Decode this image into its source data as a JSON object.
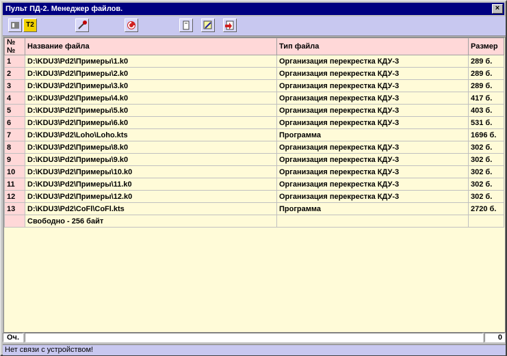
{
  "window": {
    "title": "Пульт ПД-2. Менеджер файлов.",
    "close_label": "×"
  },
  "toolbar": {
    "t2_label": "T2"
  },
  "table": {
    "headers": [
      "№№",
      "Название файла",
      "Тип файла",
      "Размер"
    ],
    "rows": [
      [
        "1",
        "D:\\KDU3\\Pd2\\Примеры\\1.k0",
        "Организация перекрестка КДУ-3",
        "289 б."
      ],
      [
        "2",
        "D:\\KDU3\\Pd2\\Примеры\\2.k0",
        "Организация перекрестка КДУ-3",
        "289 б."
      ],
      [
        "3",
        "D:\\KDU3\\Pd2\\Примеры\\3.k0",
        "Организация перекрестка КДУ-3",
        "289 б."
      ],
      [
        "4",
        "D:\\KDU3\\Pd2\\Примеры\\4.k0",
        "Организация перекрестка КДУ-3",
        "417 б."
      ],
      [
        "5",
        "D:\\KDU3\\Pd2\\Примеры\\5.k0",
        "Организация перекрестка КДУ-3",
        "403 б."
      ],
      [
        "6",
        "D:\\KDU3\\Pd2\\Примеры\\6.k0",
        "Организация перекрестка КДУ-3",
        "531 б."
      ],
      [
        "7",
        "D:\\KDU3\\Pd2\\Loho\\Loho.kts",
        "Программа",
        "1696 б."
      ],
      [
        "8",
        "D:\\KDU3\\Pd2\\Примеры\\8.k0",
        "Организация перекрестка КДУ-3",
        "302 б."
      ],
      [
        "9",
        "D:\\KDU3\\Pd2\\Примеры\\9.k0",
        "Организация перекрестка КДУ-3",
        "302 б."
      ],
      [
        "10",
        "D:\\KDU3\\Pd2\\Примеры\\10.k0",
        "Организация перекрестка КДУ-3",
        "302 б."
      ],
      [
        "11",
        "D:\\KDU3\\Pd2\\Примеры\\11.k0",
        "Организация перекрестка КДУ-3",
        "302 б."
      ],
      [
        "12",
        "D:\\KDU3\\Pd2\\Примеры\\12.k0",
        "Организация перекрестка КДУ-3",
        "302 б."
      ],
      [
        "13",
        "D:\\KDU3\\Pd2\\CoFl\\CoFl.kts",
        "Программа",
        "2720 б."
      ]
    ],
    "free_label": "Свободно - 256 байт"
  },
  "progress": {
    "left_label": "Оч.",
    "right_value": "0"
  },
  "status": {
    "text": "Нет связи с устройством!"
  }
}
